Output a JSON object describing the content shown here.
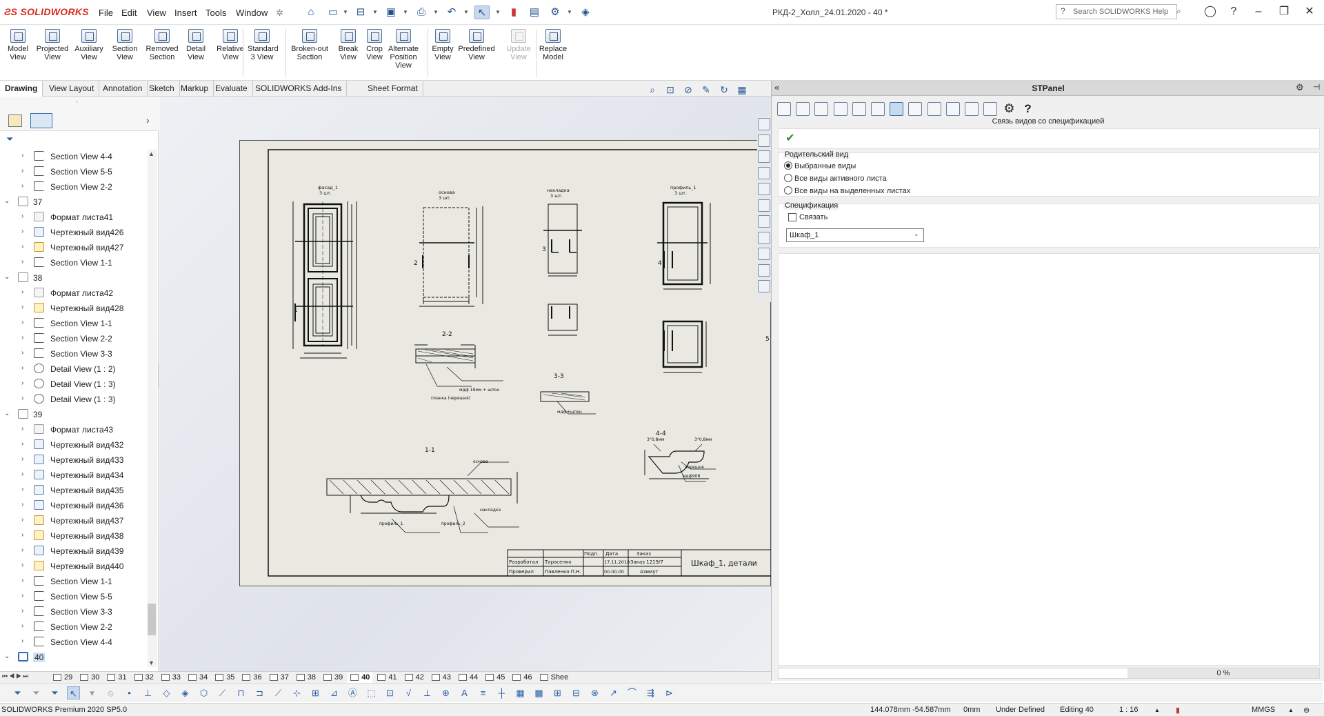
{
  "app": {
    "brand": "SOLIDWORKS",
    "doc_title": "РКД-2_Холл_24.01.2020 - 40 *",
    "search_placeholder": "Search SOLIDWORKS Help",
    "brand_color": "#da291c"
  },
  "menu": [
    "File",
    "Edit",
    "View",
    "Insert",
    "Tools",
    "Window"
  ],
  "ribbon": [
    {
      "label": "Model View"
    },
    {
      "label": "Projected View"
    },
    {
      "label": "Auxiliary View"
    },
    {
      "label": "Section View"
    },
    {
      "label": "Removed Section"
    },
    {
      "label": "Detail View"
    },
    {
      "label": "Relative View"
    },
    {
      "label": "Standard 3 View"
    },
    {
      "label": "Broken-out Section"
    },
    {
      "label": "Break View"
    },
    {
      "label": "Crop View"
    },
    {
      "label": "Alternate Position View"
    },
    {
      "label": "Empty View"
    },
    {
      "label": "Predefined View"
    },
    {
      "label": "Update View"
    },
    {
      "label": "Replace Model"
    }
  ],
  "tabs": [
    "Drawing",
    "View Layout",
    "Annotation",
    "Sketch",
    "Markup",
    "Evaluate",
    "SOLIDWORKS Add-Ins",
    "Sheet Format"
  ],
  "tree": [
    {
      "t": "sec",
      "label": "Section View 4-4"
    },
    {
      "t": "sec",
      "label": "Section View 5-5"
    },
    {
      "t": "sec",
      "label": "Section View 2-2"
    },
    {
      "t": "sheet",
      "label": "37"
    },
    {
      "t": "fmt",
      "label": "Формат листа41"
    },
    {
      "t": "dvb",
      "label": "Чертежный вид426"
    },
    {
      "t": "dv",
      "label": "Чертежный вид427"
    },
    {
      "t": "sec",
      "label": "Section View 1-1"
    },
    {
      "t": "sheet",
      "label": "38"
    },
    {
      "t": "fmt",
      "label": "Формат листа42"
    },
    {
      "t": "dv",
      "label": "Чертежный вид428"
    },
    {
      "t": "sec",
      "label": "Section View 1-1"
    },
    {
      "t": "sec",
      "label": "Section View 2-2"
    },
    {
      "t": "sec",
      "label": "Section View 3-3"
    },
    {
      "t": "det",
      "label": "Detail View  (1 : 2)"
    },
    {
      "t": "det",
      "label": "Detail View  (1 : 3)"
    },
    {
      "t": "det",
      "label": "Detail View  (1 : 3)"
    },
    {
      "t": "sheet",
      "label": "39"
    },
    {
      "t": "fmt",
      "label": "Формат листа43"
    },
    {
      "t": "dvb",
      "label": "Чертежный вид432"
    },
    {
      "t": "dvb",
      "label": "Чертежный вид433"
    },
    {
      "t": "dvb",
      "label": "Чертежный вид434"
    },
    {
      "t": "dvb",
      "label": "Чертежный вид435"
    },
    {
      "t": "dvb",
      "label": "Чертежный вид436"
    },
    {
      "t": "dv",
      "label": "Чертежный вид437"
    },
    {
      "t": "dv",
      "label": "Чертежный вид438"
    },
    {
      "t": "dvb",
      "label": "Чертежный вид439"
    },
    {
      "t": "dv",
      "label": "Чертежный вид440"
    },
    {
      "t": "sec",
      "label": "Section View 1-1"
    },
    {
      "t": "sec",
      "label": "Section View 5-5"
    },
    {
      "t": "sec",
      "label": "Section View 3-3"
    },
    {
      "t": "sec",
      "label": "Section View 2-2"
    },
    {
      "t": "sec",
      "label": "Section View 4-4"
    },
    {
      "t": "sheetsel",
      "label": "40"
    }
  ],
  "drawing": {
    "labels": {
      "v1": "фасад_1",
      "v1b": "3 шт.",
      "v2": "основа",
      "v2b": "3 шт.",
      "v3": "накладка",
      "v3b": "3 шт.",
      "v4": "профиль_1",
      "v4b": "3 шт.",
      "s22": "2-2",
      "s33": "3-3",
      "s11": "1-1",
      "s44": "4-4",
      "a1": "мдф 19мм + шпон",
      "a2": "планка (черешня)",
      "a3": "мдф+шпон",
      "a4": "основа",
      "a5": "накладка",
      "a6": "профиль_1",
      "a7": "профиль_2",
      "a8": "3°0,8мм",
      "a9": "3°0,8мм",
      "a10": "черешня",
      "a11": "мдф908",
      "n1": "1",
      "n2": "2",
      "n3": "3",
      "n4": "4",
      "n5": "5"
    },
    "titleblock": {
      "h1": "Подп.",
      "h2": "Дата",
      "h3": "Заказ",
      "r1a": "Разработал",
      "r1b": "Тарасенко",
      "r1c": "17.11.2019",
      "r1d": "Заказ 1219/7",
      "r2a": "Проверил",
      "r2b": "Павленко П.Н.",
      "r2c": "00.00.00",
      "r2d": "Азимут",
      "name": "Шкаф_1, детали"
    }
  },
  "stpanel": {
    "title": "STPanel",
    "subtitle": "Связь видов со спецификацией",
    "group1": "Родительский вид",
    "radios": [
      "Выбранные виды",
      "Все виды активного листа",
      "Все виды на выделенных листах"
    ],
    "radio_selected": 0,
    "group2": "Спецификация",
    "check_label": "Связать",
    "checked": false,
    "combo_value": "Шкаф_1",
    "progress": "0 %"
  },
  "sheettabs": [
    "29",
    "30",
    "31",
    "32",
    "33",
    "34",
    "35",
    "36",
    "37",
    "38",
    "39",
    "40",
    "41",
    "42",
    "43",
    "44",
    "45",
    "46",
    "Shee"
  ],
  "active_sheet": "40",
  "status": {
    "product": "SOLIDWORKS Premium 2020 SP5.0",
    "x": "144.078mm",
    "y": "-54.587mm",
    "z": "0mm",
    "state": "Under Defined",
    "editing": "Editing 40",
    "scale": "1 : 16",
    "units": "MMGS"
  }
}
